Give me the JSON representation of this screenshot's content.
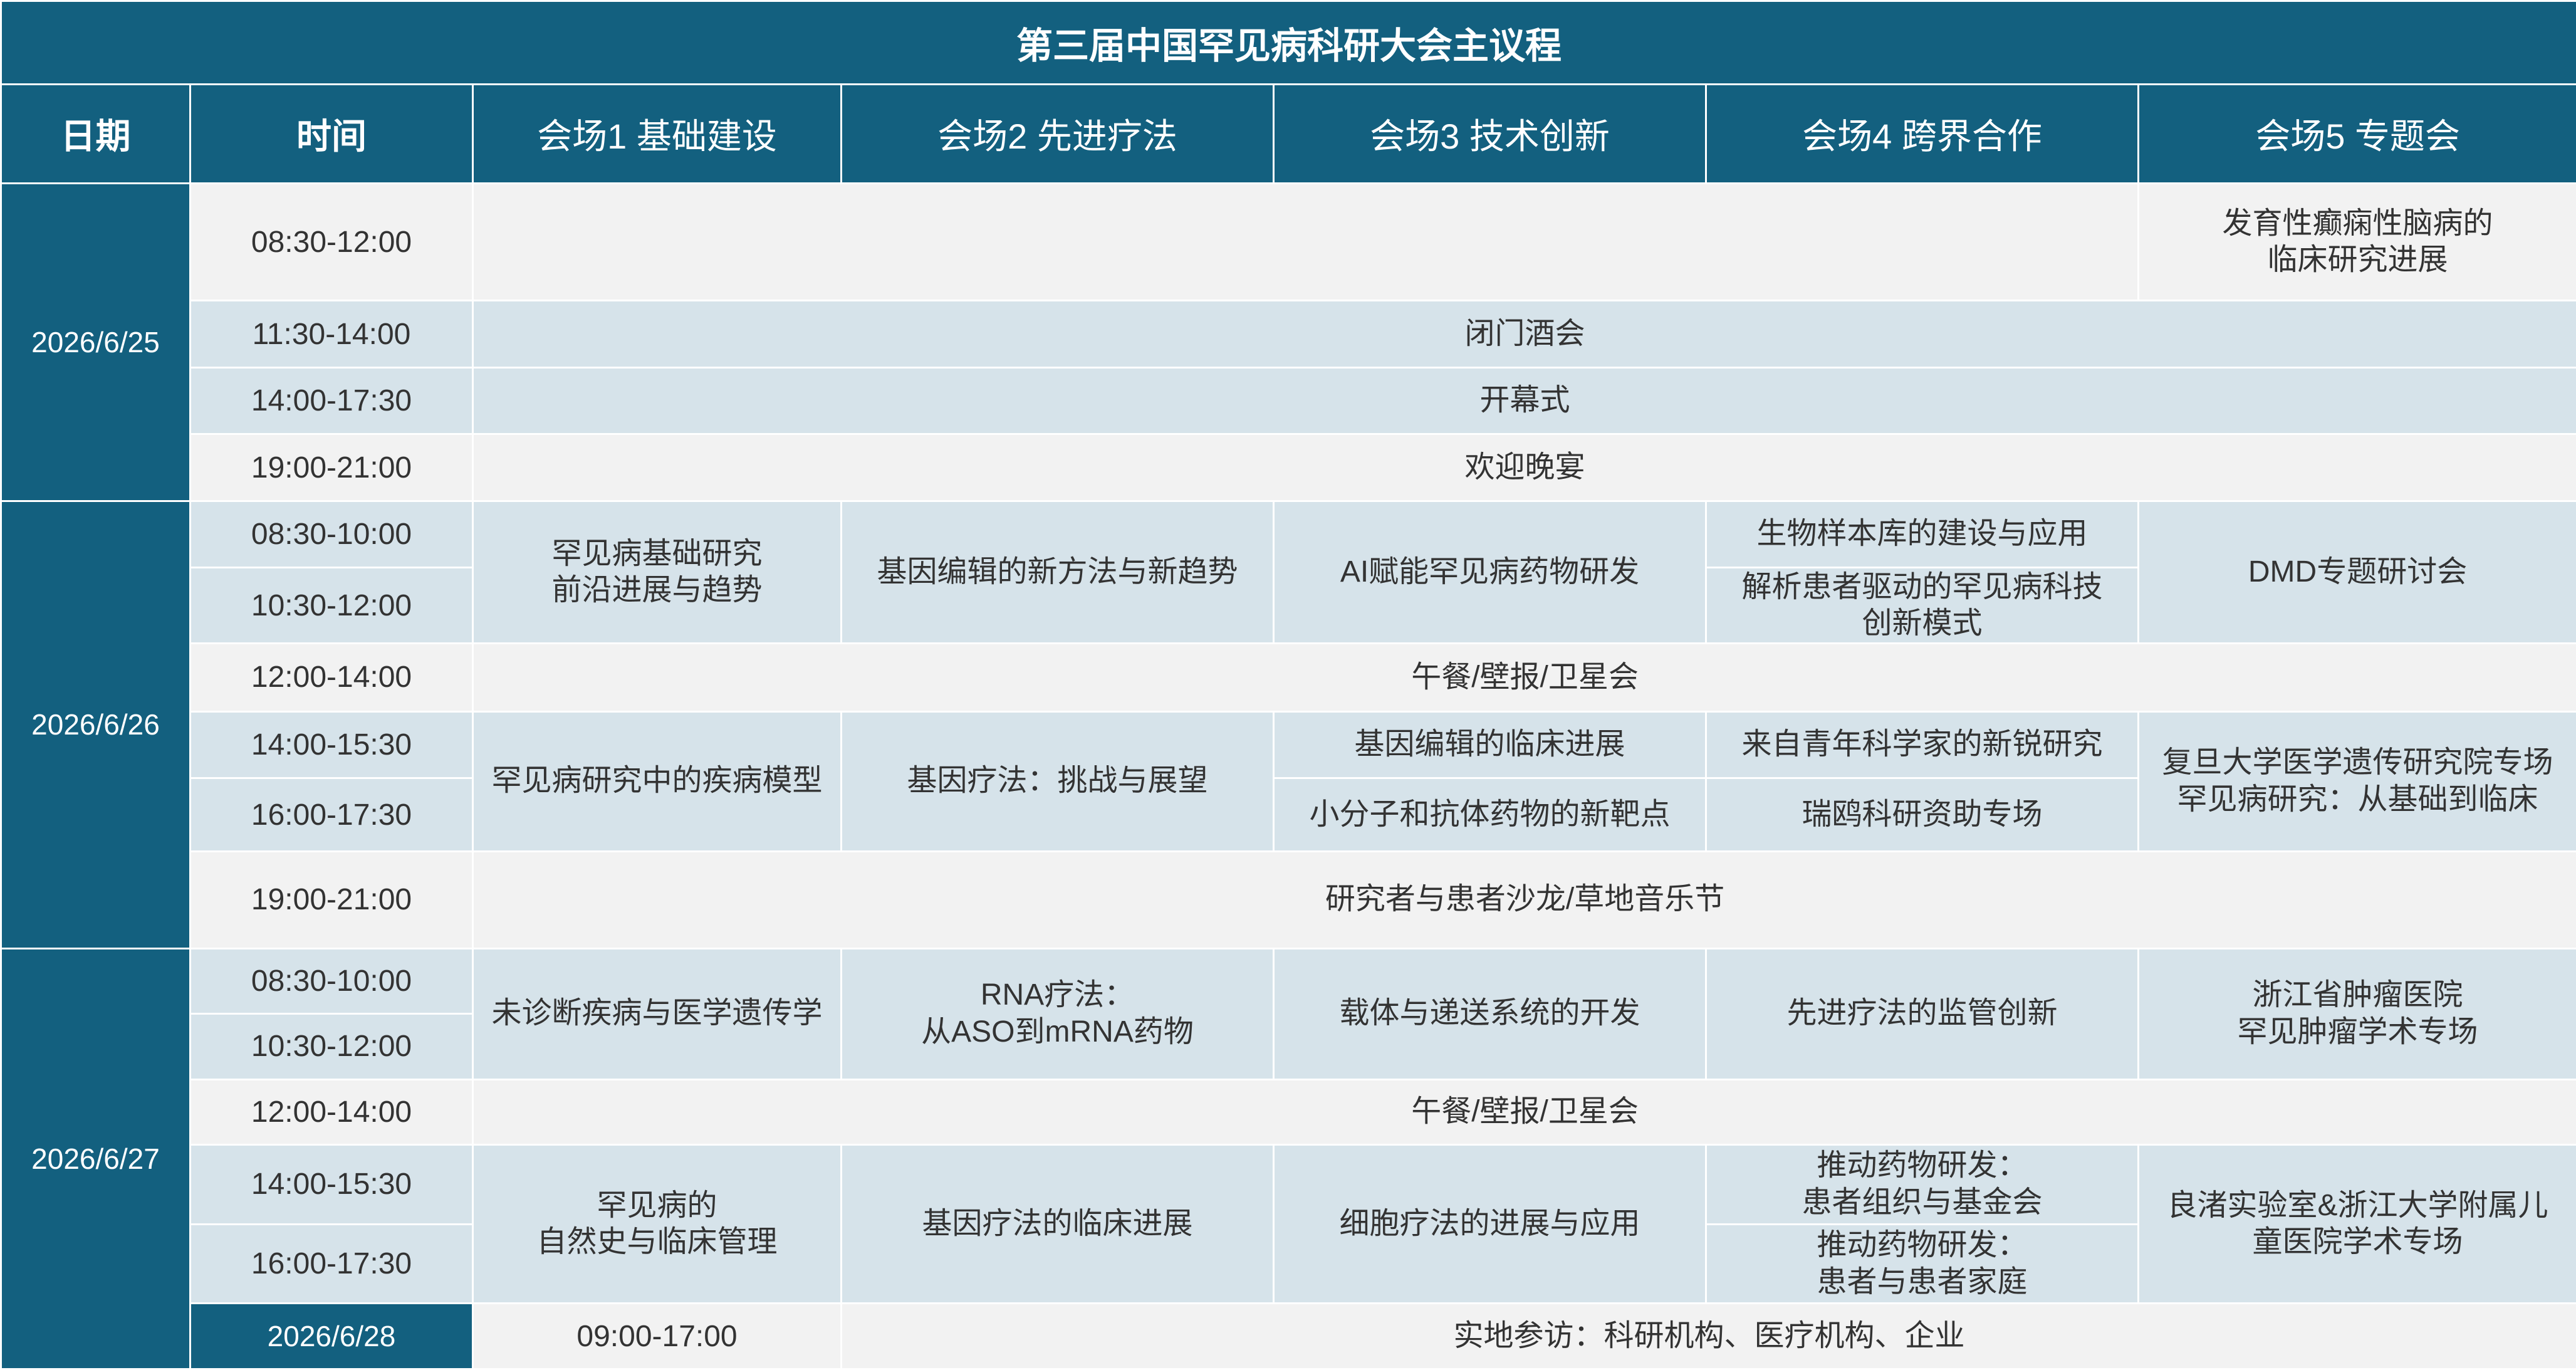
{
  "title": "第三届中国罕见病科研大会主议程",
  "headers": {
    "date": "日期",
    "time": "时间",
    "venue1": "会场1  基础建设",
    "venue2": "会场2  先进疗法",
    "venue3": "会场3  技术创新",
    "venue4": "会场4  跨界合作",
    "venue5": "会场5 专题会"
  },
  "dates": {
    "d1": "2026/6/25",
    "d2": "2026/6/26",
    "d3": "2026/6/27",
    "d4": "2026/6/28"
  },
  "times": {
    "r1": "08:30-12:00",
    "r2": "11:30-14:00",
    "r3": "14:00-17:30",
    "r4": "19:00-21:00",
    "r5": "08:30-10:00",
    "r6": "10:30-12:00",
    "r7": "12:00-14:00",
    "r8": "14:00-15:30",
    "r9": "16:00-17:30",
    "r10": "19:00-21:00",
    "r11": "08:30-10:00",
    "r12": "10:30-12:00",
    "r13": "12:00-14:00",
    "r14": "14:00-15:30",
    "r15": "16:00-17:30",
    "r16": "09:00-17:00"
  },
  "sessions": {
    "d1_morning_v5_line1": "发育性癫痫性脑病的",
    "d1_morning_v5_line2": "临床研究进展",
    "d1_closed_reception": "闭门酒会",
    "d1_opening": "开幕式",
    "d1_welcome_dinner": "欢迎晚宴",
    "d2_am_v1_line1": "罕见病基础研究",
    "d2_am_v1_line2": "前沿进展与趋势",
    "d2_am_v2": "基因编辑的新方法与新趋势",
    "d2_am_v3": "AI赋能罕见病药物研发",
    "d2_am1_v4": "生物样本库的建设与应用",
    "d2_am2_v4_line1": "解析患者驱动的罕见病科技",
    "d2_am2_v4_line2": "创新模式",
    "d2_am_v5": "DMD专题研讨会",
    "d2_lunch": "午餐/壁报/卫星会",
    "d2_pm_v1": "罕见病研究中的疾病模型",
    "d2_pm_v2": "基因疗法：挑战与展望",
    "d2_pm1_v3": "基因编辑的临床进展",
    "d2_pm1_v4": "来自青年科学家的新锐研究",
    "d2_pm_v5_line1": "复旦大学医学遗传研究院专场",
    "d2_pm_v5_line2": "罕见病研究：从基础到临床",
    "d2_pm2_v3": "小分子和抗体药物的新靶点",
    "d2_pm2_v4": "瑞鸥科研资助专场",
    "d2_evening": "研究者与患者沙龙/草地音乐节",
    "d3_am_v1": "未诊断疾病与医学遗传学",
    "d3_am_v2_line1": "RNA疗法：",
    "d3_am_v2_line2": "从ASO到mRNA药物",
    "d3_am_v3": "载体与递送系统的开发",
    "d3_am_v4": "先进疗法的监管创新",
    "d3_am_v5_line1": "浙江省肿瘤医院",
    "d3_am_v5_line2": "罕见肿瘤学术专场",
    "d3_lunch": "午餐/壁报/卫星会",
    "d3_pm_v1_line1": "罕见病的",
    "d3_pm_v1_line2": "自然史与临床管理",
    "d3_pm_v2": "基因疗法的临床进展",
    "d3_pm_v3": "细胞疗法的进展与应用",
    "d3_pm1_v4_line1": "推动药物研发：",
    "d3_pm1_v4_line2": "患者组织与基金会",
    "d3_pm2_v4_line1": "推动药物研发：",
    "d3_pm2_v4_line2": "患者与患者家庭",
    "d3_pm_v5_line1": "良渚实验室&浙江大学附属儿",
    "d3_pm_v5_line2": "童医院学术专场",
    "d4_visit": "实地参访：科研机构、医疗机构、企业"
  },
  "colors": {
    "header_bg": "#13607f",
    "light_row": "#f2f2f2",
    "blue_cell": "#d6e3ea",
    "text": "#333333"
  }
}
